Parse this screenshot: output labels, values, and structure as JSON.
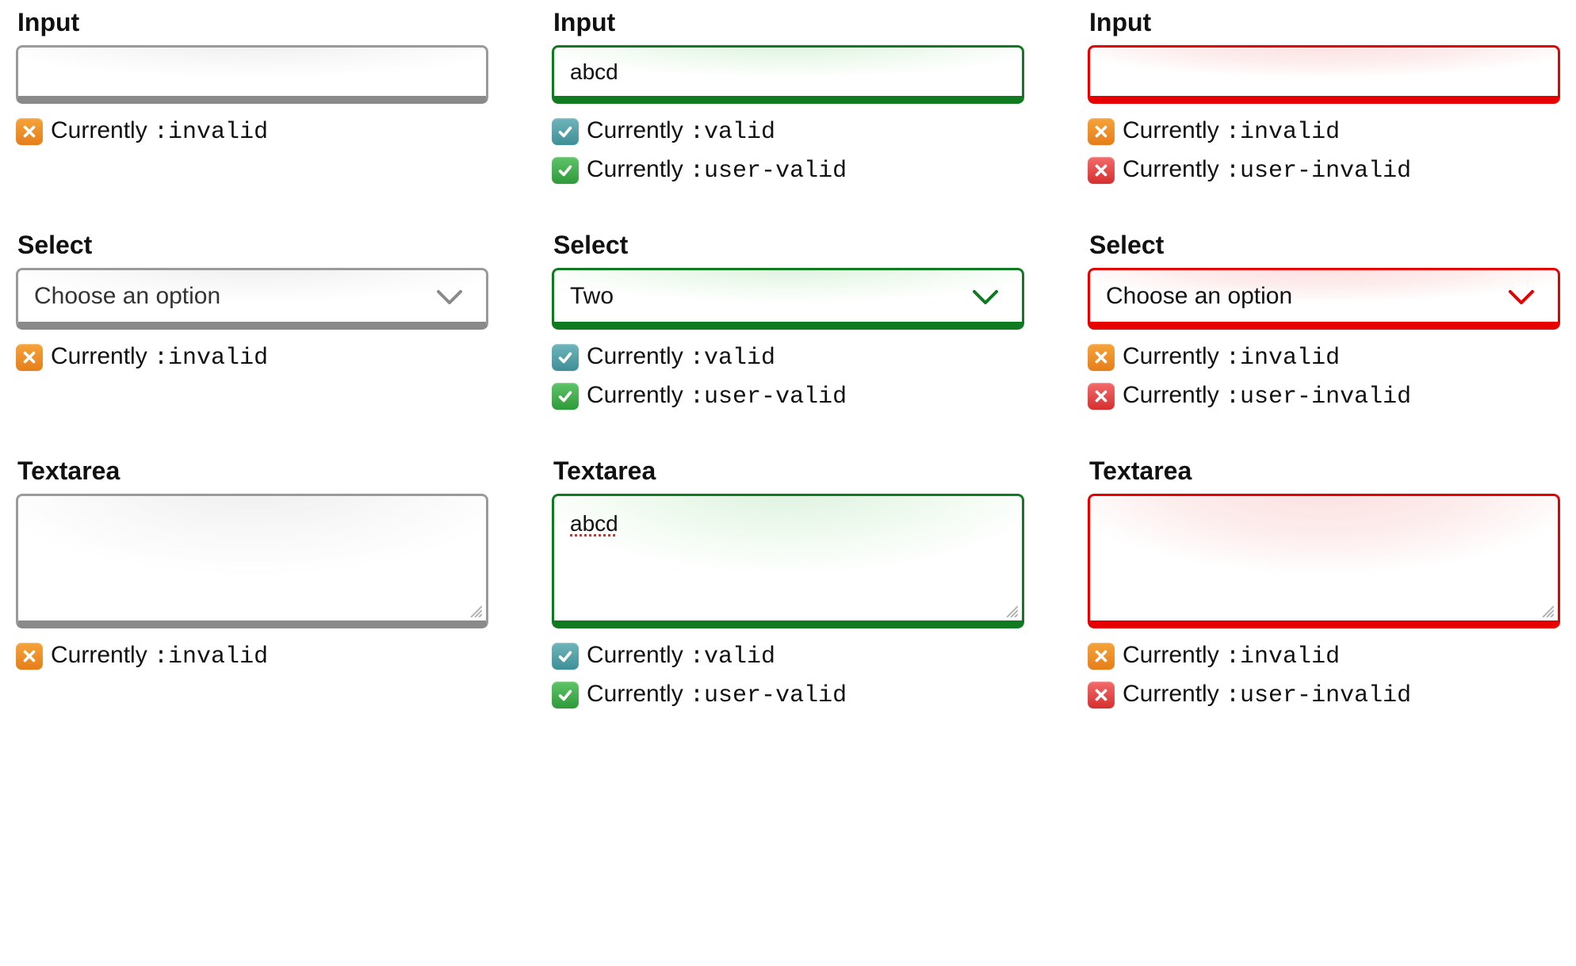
{
  "labels": {
    "input": "Input",
    "select": "Select",
    "textarea": "Textarea"
  },
  "status_prefix": "Currently ",
  "pseudo": {
    "invalid": ":invalid",
    "valid": ":valid",
    "user_valid": ":user-valid",
    "user_invalid": ":user-invalid"
  },
  "icons": {
    "orange_x": "orange",
    "teal_check": "teal",
    "green_check": "green",
    "red_x": "red"
  },
  "cells": [
    {
      "row": "input",
      "col": 1,
      "state": "neutral",
      "value": "",
      "statuses": [
        {
          "icon": "orange_x",
          "pseudo": "invalid"
        }
      ]
    },
    {
      "row": "input",
      "col": 2,
      "state": "valid",
      "value": "abcd",
      "statuses": [
        {
          "icon": "teal_check",
          "pseudo": "valid"
        },
        {
          "icon": "green_check",
          "pseudo": "user_valid"
        }
      ]
    },
    {
      "row": "input",
      "col": 3,
      "state": "invalid",
      "value": "",
      "statuses": [
        {
          "icon": "orange_x",
          "pseudo": "invalid"
        },
        {
          "icon": "red_x",
          "pseudo": "user_invalid"
        }
      ]
    },
    {
      "row": "select",
      "col": 1,
      "state": "neutral",
      "value": "Choose an option",
      "statuses": [
        {
          "icon": "orange_x",
          "pseudo": "invalid"
        }
      ]
    },
    {
      "row": "select",
      "col": 2,
      "state": "valid",
      "value": "Two",
      "statuses": [
        {
          "icon": "teal_check",
          "pseudo": "valid"
        },
        {
          "icon": "green_check",
          "pseudo": "user_valid"
        }
      ]
    },
    {
      "row": "select",
      "col": 3,
      "state": "invalid",
      "value": "Choose an option",
      "statuses": [
        {
          "icon": "orange_x",
          "pseudo": "invalid"
        },
        {
          "icon": "red_x",
          "pseudo": "user_invalid"
        }
      ]
    },
    {
      "row": "textarea",
      "col": 1,
      "state": "neutral",
      "value": "",
      "statuses": [
        {
          "icon": "orange_x",
          "pseudo": "invalid"
        }
      ]
    },
    {
      "row": "textarea",
      "col": 2,
      "state": "valid",
      "value": "abcd",
      "spellcheck_squiggle": true,
      "statuses": [
        {
          "icon": "teal_check",
          "pseudo": "valid"
        },
        {
          "icon": "green_check",
          "pseudo": "user_valid"
        }
      ]
    },
    {
      "row": "textarea",
      "col": 3,
      "state": "invalid",
      "value": "",
      "statuses": [
        {
          "icon": "orange_x",
          "pseudo": "invalid"
        },
        {
          "icon": "red_x",
          "pseudo": "user_invalid"
        }
      ]
    }
  ]
}
